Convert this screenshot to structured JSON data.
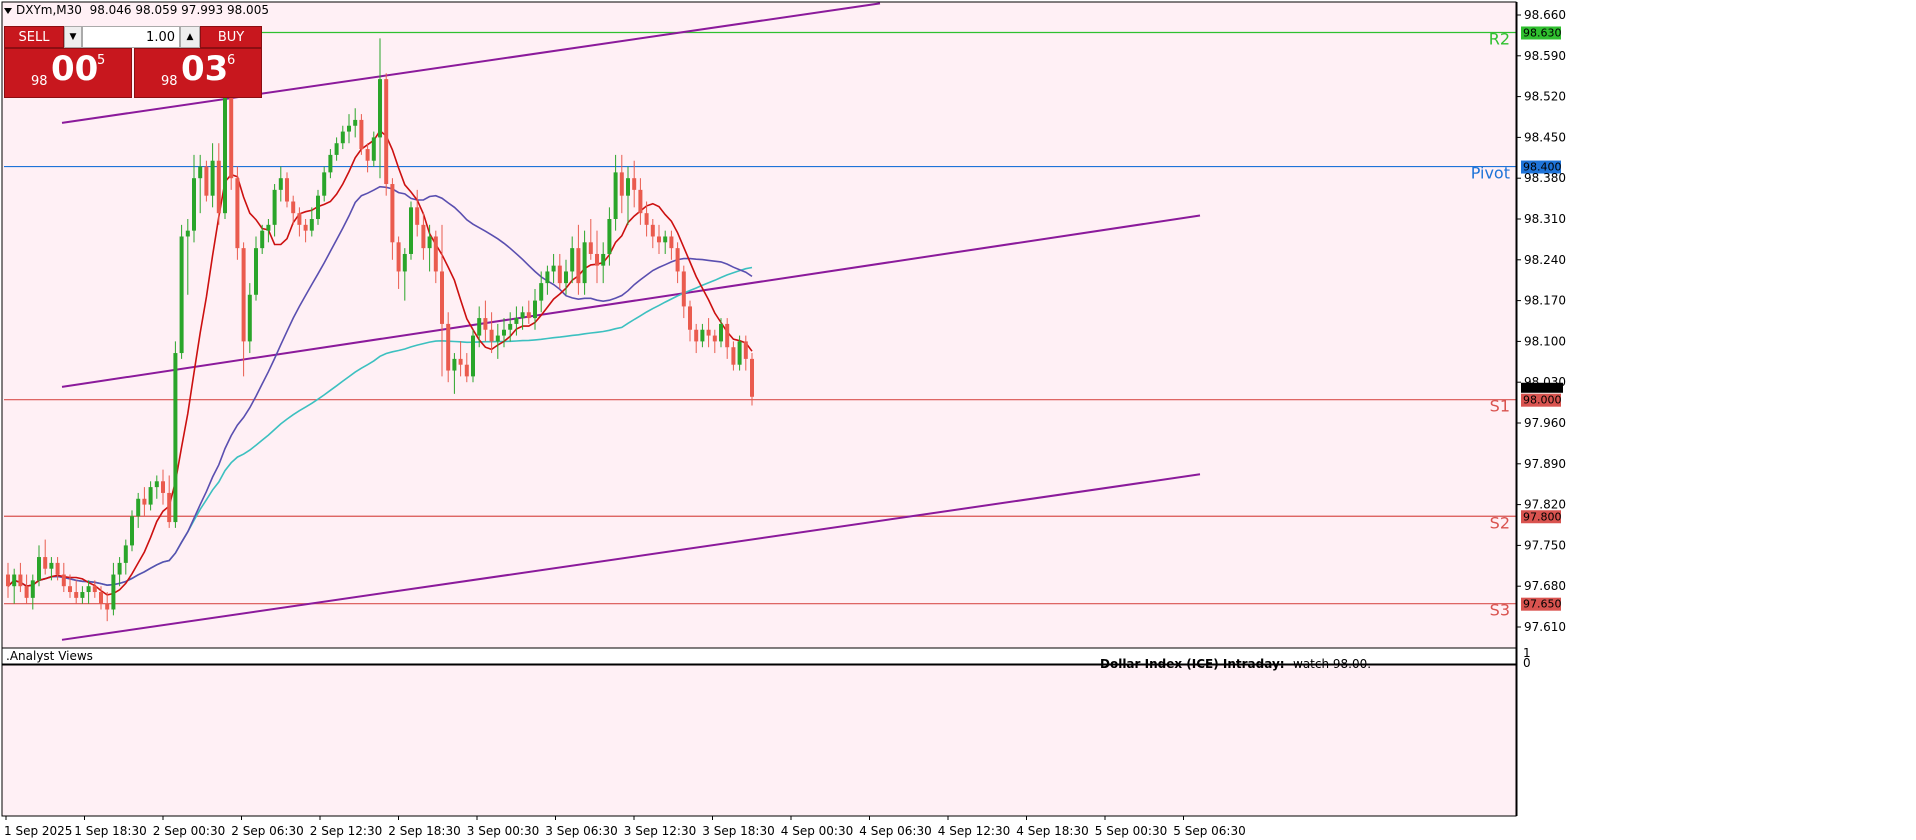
{
  "header": {
    "symbol": "DXYm,M30",
    "ohlc": "98.046 98.059 97.993 98.005"
  },
  "trade_panel": {
    "sell_label": "SELL",
    "buy_label": "BUY",
    "lot_value": "1.00",
    "sell_price": {
      "prefix": "98",
      "big": "00",
      "sup": "5"
    },
    "buy_price": {
      "prefix": "98",
      "big": "03",
      "sup": "6"
    }
  },
  "indicator_panel": {
    "title": ".Analyst Views",
    "scale_top": "1",
    "scale_bottom": "0"
  },
  "annotation": {
    "title": "Dollar Index (ICE) Intraday:",
    "text": "watch 98.00."
  },
  "levels": [
    {
      "name": "R2",
      "value": "98.630",
      "color": "#2fc02f"
    },
    {
      "name": "Pivot",
      "value": "98.400",
      "color": "#1e73d8"
    },
    {
      "name": "S1",
      "value": "98.000",
      "color": "#d9534f"
    },
    {
      "name": "S2",
      "value": "97.800",
      "color": "#d9534f"
    },
    {
      "name": "S3",
      "value": "97.650",
      "color": "#d9534f"
    }
  ],
  "price_axis_labels": [
    "98.660",
    "98.590",
    "98.520",
    "98.450",
    "98.380",
    "98.310",
    "98.240",
    "98.170",
    "98.100",
    "98.030",
    "97.960",
    "97.890",
    "97.820",
    "97.750",
    "97.680",
    "97.610"
  ],
  "current_price_label": "98.005",
  "time_axis_labels": [
    "1 Sep 2025",
    "1 Sep 18:30",
    "2 Sep 00:30",
    "2 Sep 06:30",
    "2 Sep 12:30",
    "2 Sep 18:30",
    "3 Sep 00:30",
    "3 Sep 06:30",
    "3 Sep 12:30",
    "3 Sep 18:30",
    "4 Sep 00:30",
    "4 Sep 06:30",
    "4 Sep 12:30",
    "4 Sep 18:30",
    "5 Sep 00:30",
    "5 Sep 06:30"
  ],
  "colors": {
    "background": "#fff0f5",
    "bull_candle": "#2aa52a",
    "bear_candle": "#ea5b4e",
    "ma_fast": "#cc1010",
    "ma_mid": "#5a4fb0",
    "ma_slow": "#3cc0c0",
    "channel": "#8b1a9b"
  },
  "chart_data": {
    "type": "candlestick",
    "timeframe": "M30",
    "ylim": [
      97.58,
      98.68
    ],
    "candles": [
      [
        97.7,
        97.72,
        97.66,
        97.68
      ],
      [
        97.68,
        97.71,
        97.65,
        97.7
      ],
      [
        97.7,
        97.72,
        97.67,
        97.68
      ],
      [
        97.68,
        97.7,
        97.65,
        97.66
      ],
      [
        97.66,
        97.7,
        97.64,
        97.69
      ],
      [
        97.69,
        97.75,
        97.68,
        97.73
      ],
      [
        97.73,
        97.76,
        97.7,
        97.71
      ],
      [
        97.71,
        97.73,
        97.69,
        97.72
      ],
      [
        97.72,
        97.73,
        97.69,
        97.7
      ],
      [
        97.7,
        97.72,
        97.67,
        97.68
      ],
      [
        97.68,
        97.7,
        97.66,
        97.67
      ],
      [
        97.67,
        97.69,
        97.65,
        97.66
      ],
      [
        97.66,
        97.68,
        97.65,
        97.67
      ],
      [
        97.67,
        97.69,
        97.65,
        97.68
      ],
      [
        97.68,
        97.69,
        97.66,
        97.67
      ],
      [
        97.67,
        97.68,
        97.64,
        97.65
      ],
      [
        97.65,
        97.67,
        97.62,
        97.64
      ],
      [
        97.64,
        97.72,
        97.63,
        97.7
      ],
      [
        97.7,
        97.73,
        97.68,
        97.72
      ],
      [
        97.72,
        97.76,
        97.7,
        97.75
      ],
      [
        97.75,
        97.81,
        97.74,
        97.8
      ],
      [
        97.8,
        97.84,
        97.78,
        97.83
      ],
      [
        97.83,
        97.85,
        97.8,
        97.82
      ],
      [
        97.82,
        97.86,
        97.81,
        97.85
      ],
      [
        97.85,
        97.87,
        97.83,
        97.86
      ],
      [
        97.86,
        97.88,
        97.82,
        97.84
      ],
      [
        97.84,
        97.87,
        97.78,
        97.79
      ],
      [
        97.79,
        98.1,
        97.78,
        98.08
      ],
      [
        98.08,
        98.3,
        98.07,
        98.28
      ],
      [
        98.28,
        98.31,
        98.18,
        98.29
      ],
      [
        98.29,
        98.42,
        98.27,
        98.38
      ],
      [
        98.38,
        98.42,
        98.32,
        98.4
      ],
      [
        98.4,
        98.41,
        98.34,
        98.35
      ],
      [
        98.35,
        98.44,
        98.33,
        98.41
      ],
      [
        98.41,
        98.44,
        98.3,
        98.32
      ],
      [
        98.32,
        98.6,
        98.31,
        98.56
      ],
      [
        98.56,
        98.58,
        98.36,
        98.38
      ],
      [
        98.38,
        98.4,
        98.24,
        98.26
      ],
      [
        98.26,
        98.27,
        98.04,
        98.1
      ],
      [
        98.1,
        98.2,
        98.08,
        98.18
      ],
      [
        98.18,
        98.28,
        98.17,
        98.26
      ],
      [
        98.26,
        98.3,
        98.25,
        98.29
      ],
      [
        98.29,
        98.31,
        98.27,
        98.3
      ],
      [
        98.3,
        98.37,
        98.28,
        98.36
      ],
      [
        98.36,
        98.4,
        98.34,
        98.38
      ],
      [
        98.38,
        98.39,
        98.33,
        98.34
      ],
      [
        98.34,
        98.35,
        98.3,
        98.32
      ],
      [
        98.32,
        98.33,
        98.28,
        98.3
      ],
      [
        98.3,
        98.31,
        98.27,
        98.29
      ],
      [
        98.29,
        98.33,
        98.28,
        98.31
      ],
      [
        98.31,
        98.36,
        98.3,
        98.35
      ],
      [
        98.35,
        98.4,
        98.34,
        98.39
      ],
      [
        98.39,
        98.43,
        98.38,
        98.42
      ],
      [
        98.42,
        98.45,
        98.41,
        98.44
      ],
      [
        98.44,
        98.47,
        98.43,
        98.46
      ],
      [
        98.46,
        98.49,
        98.44,
        98.47
      ],
      [
        98.47,
        98.5,
        98.45,
        98.48
      ],
      [
        98.48,
        98.49,
        98.42,
        98.43
      ],
      [
        98.43,
        98.44,
        98.39,
        98.41
      ],
      [
        98.41,
        98.46,
        98.4,
        98.45
      ],
      [
        98.45,
        98.62,
        98.38,
        98.55
      ],
      [
        98.55,
        98.56,
        98.35,
        98.37
      ],
      [
        98.37,
        98.38,
        98.24,
        98.27
      ],
      [
        98.27,
        98.28,
        98.19,
        98.22
      ],
      [
        98.22,
        98.26,
        98.17,
        98.25
      ],
      [
        98.25,
        98.34,
        98.24,
        98.33
      ],
      [
        98.33,
        98.36,
        98.28,
        98.3
      ],
      [
        98.3,
        98.32,
        98.24,
        98.26
      ],
      [
        98.26,
        98.3,
        98.22,
        98.28
      ],
      [
        98.28,
        98.29,
        98.2,
        98.22
      ],
      [
        98.22,
        98.3,
        98.04,
        98.13
      ],
      [
        98.13,
        98.15,
        98.03,
        98.05
      ],
      [
        98.05,
        98.08,
        98.01,
        98.07
      ],
      [
        98.07,
        98.1,
        98.04,
        98.06
      ],
      [
        98.06,
        98.08,
        98.03,
        98.04
      ],
      [
        98.04,
        98.12,
        98.03,
        98.11
      ],
      [
        98.11,
        98.16,
        98.09,
        98.14
      ],
      [
        98.14,
        98.17,
        98.1,
        98.12
      ],
      [
        98.12,
        98.15,
        98.08,
        98.1
      ],
      [
        98.1,
        98.13,
        98.07,
        98.11
      ],
      [
        98.11,
        98.14,
        98.09,
        98.12
      ],
      [
        98.12,
        98.15,
        98.1,
        98.13
      ],
      [
        98.13,
        98.16,
        98.11,
        98.14
      ],
      [
        98.14,
        98.16,
        98.12,
        98.15
      ],
      [
        98.15,
        98.17,
        98.13,
        98.14
      ],
      [
        98.14,
        98.19,
        98.12,
        98.17
      ],
      [
        98.17,
        98.22,
        98.15,
        98.2
      ],
      [
        98.2,
        98.23,
        98.18,
        98.22
      ],
      [
        98.22,
        98.25,
        98.2,
        98.23
      ],
      [
        98.23,
        98.25,
        98.19,
        98.2
      ],
      [
        98.2,
        98.24,
        98.18,
        98.22
      ],
      [
        98.22,
        98.28,
        98.2,
        98.26
      ],
      [
        98.26,
        98.3,
        98.18,
        98.2
      ],
      [
        98.2,
        98.29,
        98.18,
        98.27
      ],
      [
        98.27,
        98.31,
        98.24,
        98.25
      ],
      [
        98.25,
        98.29,
        98.2,
        98.23
      ],
      [
        98.23,
        98.27,
        98.2,
        98.25
      ],
      [
        98.25,
        98.33,
        98.23,
        98.31
      ],
      [
        98.31,
        98.42,
        98.29,
        98.39
      ],
      [
        98.39,
        98.42,
        98.32,
        98.35
      ],
      [
        98.35,
        98.4,
        98.3,
        98.38
      ],
      [
        98.38,
        98.41,
        98.33,
        98.36
      ],
      [
        98.36,
        98.38,
        98.3,
        98.32
      ],
      [
        98.32,
        98.34,
        98.28,
        98.3
      ],
      [
        98.3,
        98.31,
        98.26,
        98.28
      ],
      [
        98.28,
        98.3,
        98.25,
        98.27
      ],
      [
        98.27,
        98.29,
        98.25,
        98.28
      ],
      [
        98.28,
        98.29,
        98.24,
        98.26
      ],
      [
        98.26,
        98.27,
        98.2,
        98.22
      ],
      [
        98.22,
        98.23,
        98.14,
        98.16
      ],
      [
        98.16,
        98.17,
        98.1,
        98.12
      ],
      [
        98.12,
        98.13,
        98.08,
        98.1
      ],
      [
        98.1,
        98.13,
        98.09,
        98.12
      ],
      [
        98.12,
        98.14,
        98.09,
        98.11
      ],
      [
        98.11,
        98.12,
        98.08,
        98.1
      ],
      [
        98.1,
        98.14,
        98.09,
        98.13
      ],
      [
        98.13,
        98.14,
        98.07,
        98.09
      ],
      [
        98.09,
        98.1,
        98.05,
        98.06
      ],
      [
        98.06,
        98.11,
        98.05,
        98.1
      ],
      [
        98.1,
        98.11,
        98.05,
        98.07
      ],
      [
        98.07,
        98.08,
        97.99,
        98.005
      ]
    ]
  }
}
